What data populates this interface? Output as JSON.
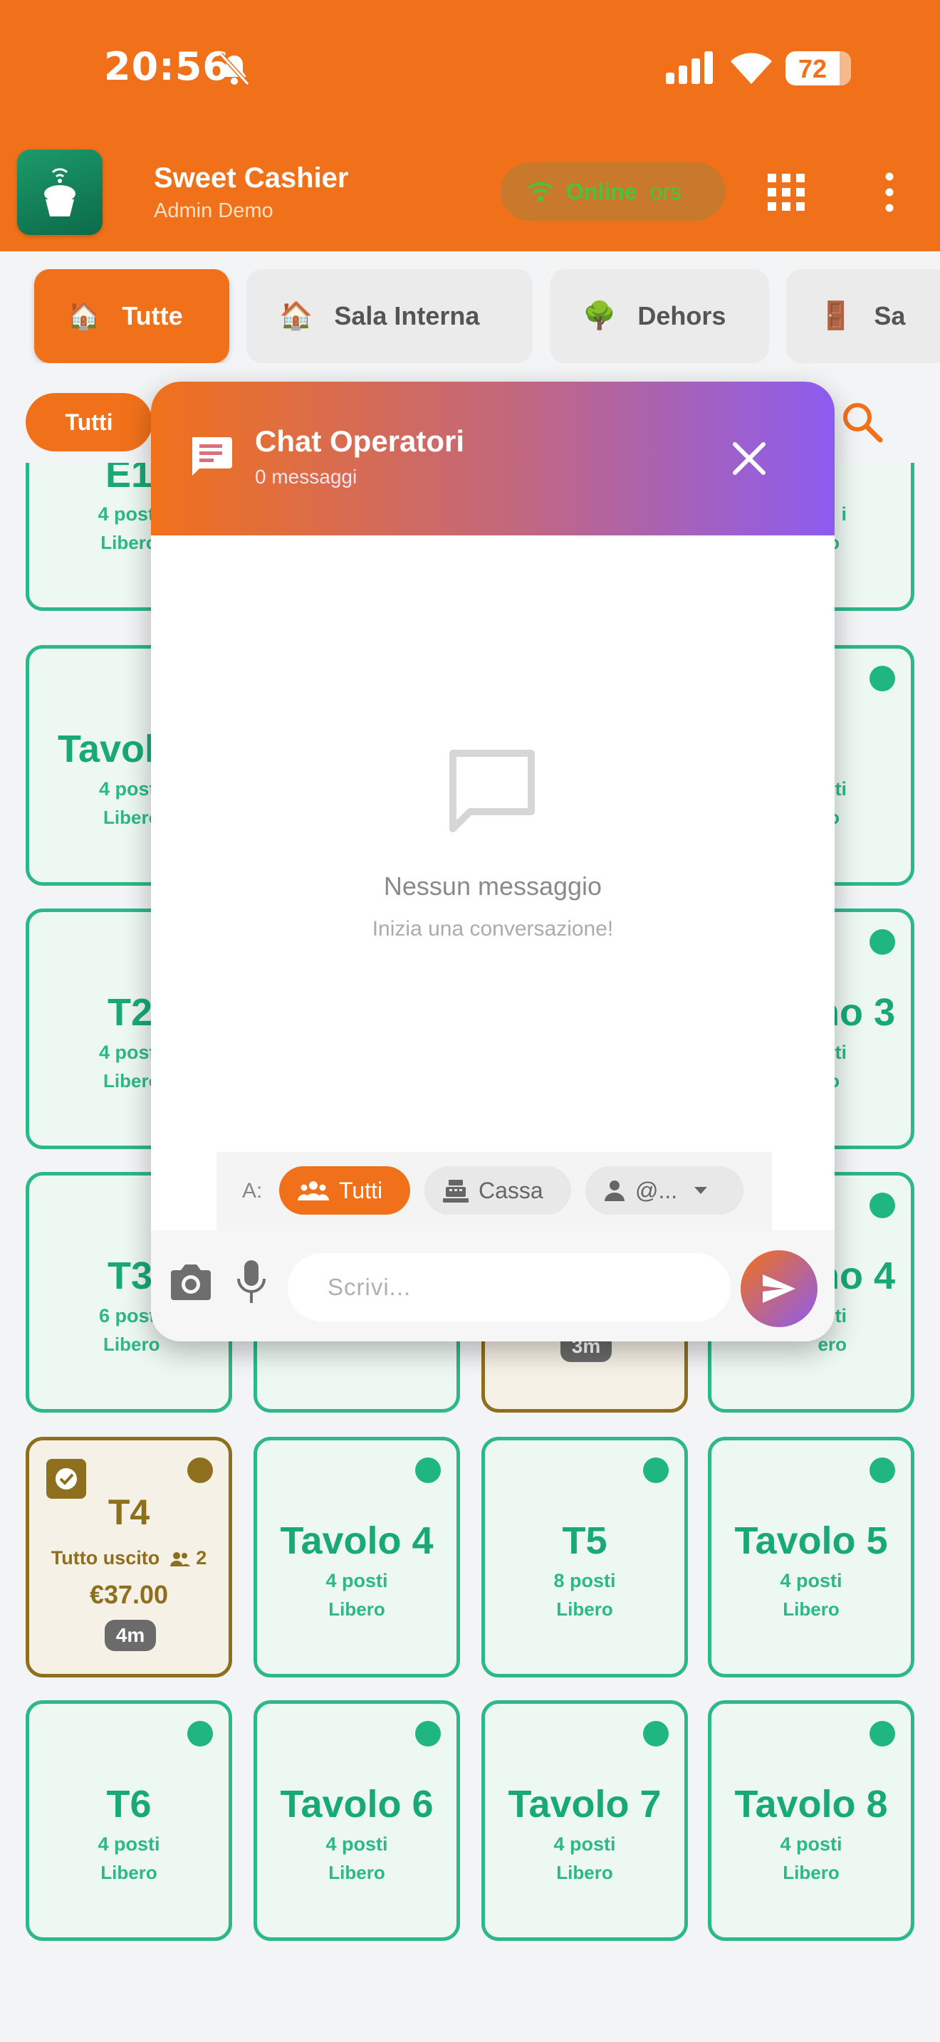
{
  "status_bar": {
    "time": "20:56",
    "battery": "72"
  },
  "header": {
    "app_name": "Sweet Cashier",
    "user": "Admin Demo",
    "connection_label": "Online",
    "connection_extra": "ors",
    "accent": "#f1711b"
  },
  "rooms": [
    {
      "label": "Tutte",
      "icon": "🏠",
      "active": true
    },
    {
      "label": "Sala Interna",
      "icon": "🏠",
      "active": false
    },
    {
      "label": "Dehors",
      "icon": "🌳",
      "active": false
    },
    {
      "label": "Sa",
      "icon": "🚪",
      "active": false
    }
  ],
  "filter": {
    "label": "Tutti"
  },
  "tables": {
    "row1": [
      {
        "name": "E1",
        "seats": "4 posti",
        "state": "Libero"
      },
      {
        "name": "",
        "seats": "i",
        "state": "o"
      }
    ],
    "row2": [
      {
        "name": "Tavol",
        "seats": "4 post",
        "state": "Libero"
      },
      {
        "name": "",
        "seats": "ti",
        "state": "o"
      }
    ],
    "row3": [
      {
        "name": "T2",
        "seats": "4 post",
        "state": "Libero"
      },
      {
        "name": "no 3",
        "seats": "ti",
        "state": "o"
      }
    ],
    "row4": [
      {
        "name": "T3",
        "seats": "6 post",
        "state": "Libero"
      },
      {
        "name": "no 4",
        "seats": "ti",
        "state": "ero"
      }
    ],
    "row4_timer": "3m",
    "t4": {
      "name": "T4",
      "status": "Tutto uscito",
      "guests": "2",
      "amount": "€37.00",
      "timer": "4m"
    },
    "row5": [
      {
        "name": "Tavolo 4",
        "seats": "4 posti",
        "state": "Libero"
      },
      {
        "name": "T5",
        "seats": "8 posti",
        "state": "Libero"
      },
      {
        "name": "Tavolo 5",
        "seats": "4 posti",
        "state": "Libero"
      }
    ],
    "row6": [
      {
        "name": "T6",
        "seats": "4 posti",
        "state": "Libero"
      },
      {
        "name": "Tavolo 6",
        "seats": "4 posti",
        "state": "Libero"
      },
      {
        "name": "Tavolo 7",
        "seats": "4 posti",
        "state": "Libero"
      },
      {
        "name": "Tavolo 8",
        "seats": "4 posti",
        "state": "Libero"
      }
    ]
  },
  "chat": {
    "title": "Chat Operatori",
    "count": "0 messaggi",
    "empty_title": "Nessun messaggio",
    "empty_subtitle": "Inizia una conversazione!",
    "to_label": "A:",
    "recipients": {
      "all": "Tutti",
      "cassa": "Cassa",
      "user": "@..."
    },
    "input_placeholder": "Scrivi..."
  }
}
